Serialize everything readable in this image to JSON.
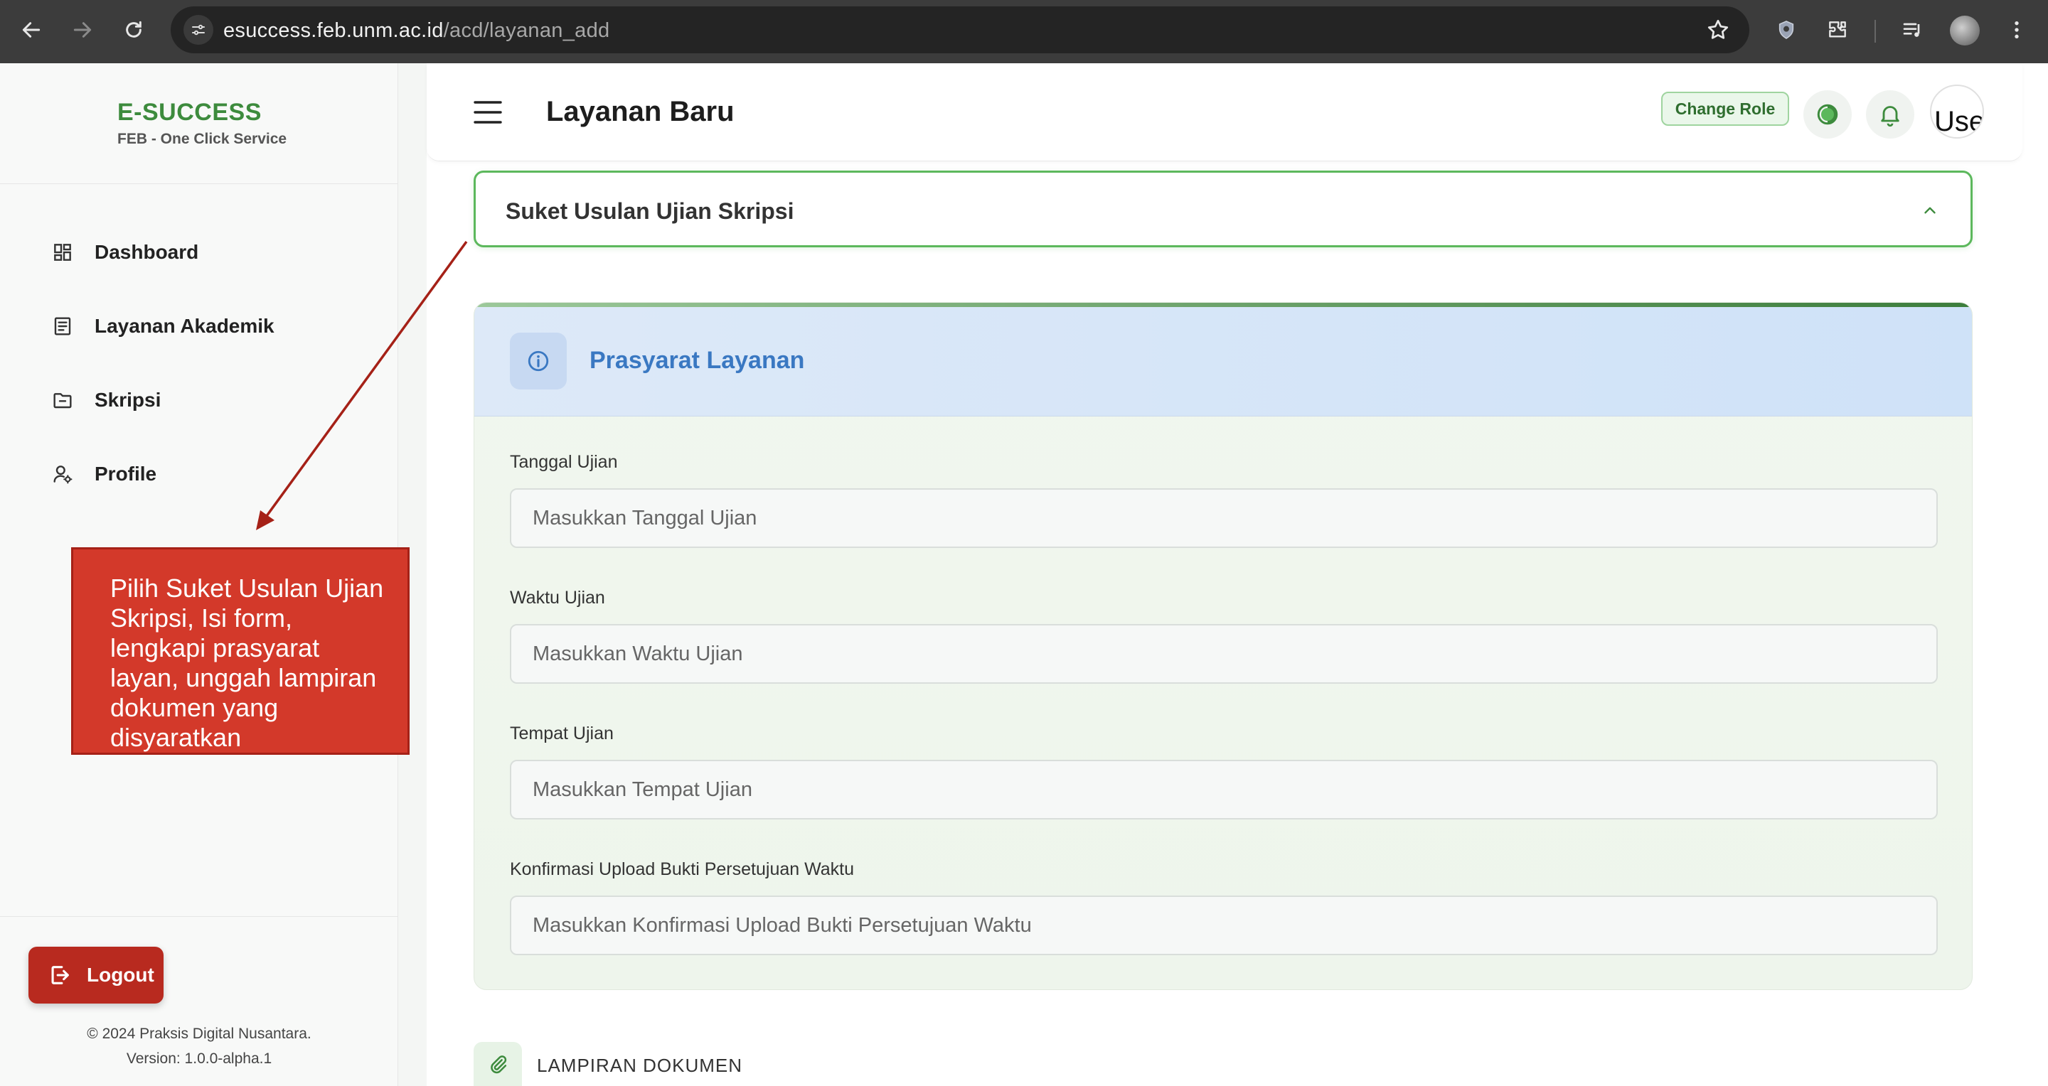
{
  "browser": {
    "url_host": "esuccess.feb.unm.ac.id",
    "url_path": "/acd/layanan_add"
  },
  "sidebar": {
    "brand_title": "E-SUCCESS",
    "brand_subtitle": "FEB - One Click Service",
    "items": [
      {
        "label": "Dashboard",
        "icon": "dashboard-icon"
      },
      {
        "label": "Layanan Akademik",
        "icon": "document-list-icon"
      },
      {
        "label": "Skripsi",
        "icon": "folder-icon"
      },
      {
        "label": "Profile",
        "icon": "user-settings-icon"
      }
    ],
    "logout_label": "Logout",
    "copyright": "© 2024 Praksis Digital Nusantara.",
    "version": "Version: 1.0.0-alpha.1"
  },
  "callout": {
    "text": "Pilih Suket Usulan Ujian Skripsi, Isi form, lengkapi prasyarat layan, unggah lampiran dokumen yang disyaratkan"
  },
  "header": {
    "title": "Layanan Baru",
    "change_role_label": "Change Role",
    "avatar_alt": "Use"
  },
  "service_select": {
    "selected": "Suket Usulan Ujian Skripsi"
  },
  "prasyarat": {
    "title": "Prasyarat Layanan",
    "fields": [
      {
        "label": "Tanggal Ujian",
        "placeholder": "Masukkan Tanggal Ujian",
        "value": ""
      },
      {
        "label": "Waktu Ujian",
        "placeholder": "Masukkan Waktu Ujian",
        "value": ""
      },
      {
        "label": "Tempat Ujian",
        "placeholder": "Masukkan Tempat Ujian",
        "value": ""
      },
      {
        "label": "Konfirmasi Upload Bukti Persetujuan Waktu",
        "placeholder": "Masukkan Konfirmasi Upload Bukti Persetujuan Waktu",
        "value": ""
      }
    ]
  },
  "lampiran": {
    "title": "LAMPIRAN DOKUMEN"
  },
  "colors": {
    "brand_green": "#3d8b3d",
    "accent_blue": "#3a78c2",
    "logout_red": "#b82a1f",
    "callout_red": "#d3392a"
  }
}
